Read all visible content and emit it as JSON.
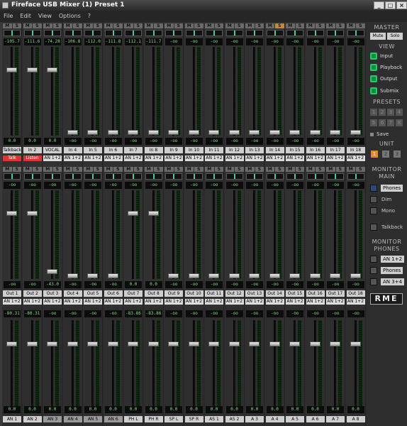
{
  "window": {
    "title": "Fireface USB Mixer (1) Preset 1",
    "controls": {
      "minimize": "_",
      "maximize": "□",
      "close": "×"
    }
  },
  "menu": [
    "File",
    "Edit",
    "View",
    "Options",
    "?"
  ],
  "mute_label": "M",
  "solo_label": "S",
  "inputs": {
    "gains": [
      "-105.7",
      "-111.6",
      "-74.28",
      "-106.8",
      "-112.0",
      "-111.8",
      "-112.1",
      "-111.7",
      "-oo",
      "-oo",
      "-oo",
      "-oo",
      "-oo",
      "-oo",
      "-oo",
      "-oo",
      "-oo",
      "-oo"
    ],
    "fader_values": [
      "0.0",
      "0.0",
      "0.0",
      "-oo",
      "-oo",
      "-oo",
      "-oo",
      "-oo",
      "-oo",
      "-oo",
      "-oo",
      "-oo",
      "-oo",
      "-oo",
      "-oo",
      "-oo",
      "-oo",
      "-oo"
    ],
    "fader_levels": [
      0.75,
      0.75,
      0.75,
      0.0,
      0.0,
      0.0,
      0.0,
      0.0,
      0.0,
      0.0,
      0.0,
      0.0,
      0.0,
      0.0,
      0.0,
      0.0,
      0.0,
      0.0
    ],
    "names": [
      "Talkback",
      "In 2",
      "VOCAL",
      "In 4",
      "In 5",
      "In 6",
      "In 7",
      "In 8",
      "In 9",
      "In 10",
      "In 11",
      "In 12",
      "In 13",
      "In 14",
      "In 15",
      "In 16",
      "In 17",
      "In 18"
    ],
    "routes": [
      "Talk",
      "Listen",
      "AN 1+2",
      "AN 1+2",
      "AN 1+2",
      "AN 1+2",
      "AN 1+2",
      "AN 1+2",
      "AN 1+2",
      "AN 1+2",
      "AN 1+2",
      "AN 1+2",
      "AN 1+2",
      "AN 1+2",
      "AN 1+2",
      "AN 1+2",
      "AN 1+2",
      "AN 1+2"
    ],
    "solo_active": [
      false,
      false,
      false,
      false,
      false,
      false,
      false,
      false,
      false,
      false,
      false,
      false,
      false,
      true,
      false,
      false,
      false,
      false
    ]
  },
  "playback": {
    "gains": [
      "-oo",
      "-oo",
      "-oo",
      "-oo",
      "-oo",
      "-oo",
      "-oo",
      "-oo",
      "-oo",
      "-oo",
      "-oo",
      "-oo",
      "-oo",
      "-oo",
      "-oo",
      "-oo",
      "-oo",
      "-oo"
    ],
    "fader_values": [
      "-oo",
      "-oo",
      "-43.0",
      "-oo",
      "-oo",
      "-oo",
      "0.0",
      "0.0",
      "-oo",
      "-oo",
      "-oo",
      "-oo",
      "-oo",
      "-oo",
      "-oo",
      "-oo",
      "-oo",
      "-oo"
    ],
    "fader_levels": [
      0.75,
      0.75,
      0.05,
      0.0,
      0.0,
      0.0,
      0.75,
      0.75,
      0.0,
      0.0,
      0.0,
      0.0,
      0.0,
      0.0,
      0.0,
      0.0,
      0.0,
      0.0
    ],
    "names": [
      "Out 1",
      "Out 2",
      "Out 3",
      "Out 4",
      "Out 5",
      "Out 6",
      "Out 7",
      "Out 8",
      "Out 9",
      "Out 10",
      "Out 11",
      "Out 12",
      "Out 13",
      "Out 14",
      "Out 15",
      "Out 16",
      "Out 17",
      "Out 18"
    ],
    "routes": [
      "AN 1+2",
      "AN 1+2",
      "AN 1+2",
      "AN 1+2",
      "AN 1+2",
      "AN 1+2",
      "AN 1+2",
      "AN 1+2",
      "AN 1+2",
      "AN 1+2",
      "AN 1+2",
      "AN 1+2",
      "AN 1+2",
      "AN 1+2",
      "AN 1+2",
      "AN 1+2",
      "AN 1+2",
      "AN 1+2"
    ]
  },
  "outputs": {
    "levels": [
      "-80.31",
      "-80.31",
      "-oo",
      "-oo",
      "-oo",
      "-oo",
      "-83.86",
      "-83.86",
      "-oo",
      "-oo",
      "-oo",
      "-oo",
      "-oo",
      "-oo",
      "-oo",
      "-oo",
      "-oo",
      "-oo"
    ],
    "fader_values": [
      "0.0",
      "0.0",
      "0.0",
      "0.0",
      "0.0",
      "0.0",
      "0.0",
      "0.0",
      "0.0",
      "0.0",
      "0.0",
      "0.0",
      "0.0",
      "0.0",
      "0.0",
      "0.0",
      "0.0",
      "0.0"
    ],
    "fader_levels": [
      0.75,
      0.75,
      0.75,
      0.75,
      0.75,
      0.75,
      0.75,
      0.75,
      0.75,
      0.75,
      0.75,
      0.75,
      0.75,
      0.75,
      0.75,
      0.75,
      0.75,
      0.75
    ],
    "names": [
      "AN 1",
      "AN 2",
      "AN 3",
      "AN 4",
      "AN 5",
      "AN 6",
      "PH L",
      "PH R",
      "SP L",
      "SP R",
      "AS 1",
      "AS 2",
      "A 3",
      "A 4",
      "A 5",
      "A 6",
      "A 7",
      "A 8"
    ],
    "active": [
      true,
      true,
      false,
      false,
      false,
      false,
      true,
      true,
      true,
      true,
      true,
      true,
      true,
      true,
      true,
      true,
      true,
      true
    ]
  },
  "sidebar": {
    "master": {
      "title": "MASTER",
      "mute": "Mute",
      "solo": "Solo"
    },
    "view": {
      "title": "VIEW",
      "items": [
        "Input",
        "Playback",
        "Output",
        "Submix"
      ]
    },
    "presets": {
      "title": "PRESETS",
      "numbers": [
        "1",
        "2",
        "3",
        "4",
        "5",
        "6",
        "7",
        "8"
      ],
      "save": "Save"
    },
    "unit": {
      "title": "UNIT",
      "numbers": [
        "1",
        "2",
        "3"
      ],
      "active": 0
    },
    "monitor_main": {
      "title_1": "MONITOR",
      "title_2": "MAIN",
      "phones": "Phones",
      "dim": "Dim",
      "mono": "Mono",
      "talkback": "Talkback"
    },
    "monitor_phones": {
      "title_1": "MONITOR",
      "title_2": "PHONES",
      "items": [
        "AN 1+2",
        "Phones",
        "AN 3+4"
      ]
    },
    "logo": "RME"
  }
}
